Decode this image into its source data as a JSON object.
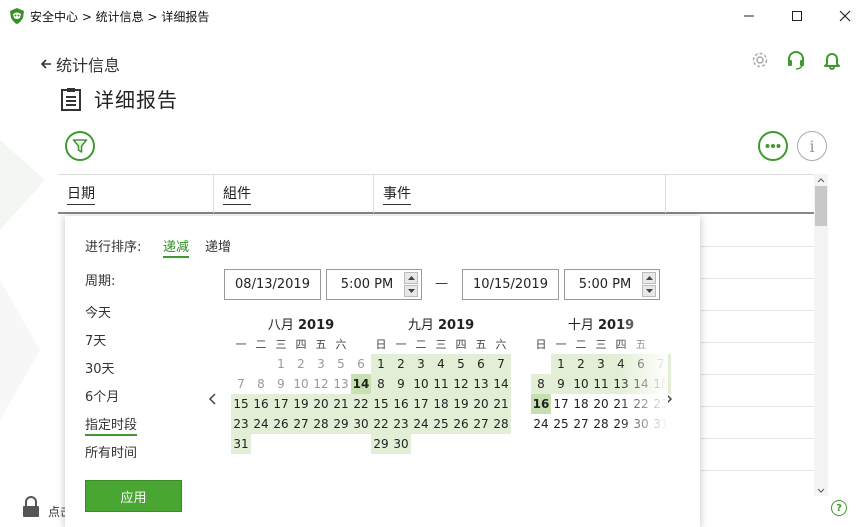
{
  "window": {
    "title": "安全中心 > 统计信息 > 详细报告"
  },
  "header": {
    "back_label": "统计信息",
    "page_title": "详细报告"
  },
  "table": {
    "columns": [
      "日期",
      "組件",
      "事件"
    ]
  },
  "footer": {
    "lock_text": "点击"
  },
  "filter": {
    "sort_label": "进行排序:",
    "sort_desc": "递减",
    "sort_asc": "递增",
    "period_label": "周期:",
    "periods": [
      "今天",
      "7天",
      "30天",
      "6个月",
      "指定时段",
      "所有时间"
    ],
    "active_period": "指定时段",
    "start_date": "08/13/2019",
    "start_time": "5:00 PM",
    "end_date": "10/15/2019",
    "end_time": "5:00 PM",
    "range_dash": "—",
    "apply_label": "应用"
  },
  "calendars": [
    {
      "month": "八月",
      "year": "2019",
      "weekdays": [
        "一",
        "二",
        "三",
        "四",
        "五",
        "六"
      ],
      "weeks": [
        [
          "",
          "",
          "",
          "1",
          "2",
          "3"
        ],
        [
          "5",
          "6",
          "7",
          "8",
          "9",
          "10"
        ],
        [
          "12",
          "13",
          "14",
          "15",
          "16",
          "17"
        ],
        [
          "19",
          "20",
          "21",
          "22",
          "23",
          "24"
        ],
        [
          "26",
          "27",
          "28",
          "29",
          "30",
          "31"
        ]
      ]
    },
    {
      "month": "九月",
      "year": "2019",
      "weekdays": [
        "日",
        "一",
        "二",
        "三",
        "四",
        "五",
        "六"
      ],
      "weeks": [
        [
          "1",
          "2",
          "3",
          "4",
          "5",
          "6",
          "7"
        ],
        [
          "8",
          "9",
          "10",
          "11",
          "12",
          "13",
          "14"
        ],
        [
          "15",
          "16",
          "17",
          "18",
          "19",
          "20",
          "21"
        ],
        [
          "22",
          "23",
          "24",
          "25",
          "26",
          "27",
          "28"
        ],
        [
          "29",
          "30",
          "",
          "",
          "",
          "",
          ""
        ]
      ]
    },
    {
      "month": "十月",
      "year": "2019",
      "weekdays": [
        "日",
        "一",
        "二",
        "三",
        "四",
        "五"
      ],
      "weeks": [
        [
          "",
          "",
          "1",
          "2",
          "3",
          "4"
        ],
        [
          "6",
          "7",
          "8",
          "9",
          "10",
          "11"
        ],
        [
          "13",
          "14",
          "15",
          "16",
          "17",
          "18"
        ],
        [
          "20",
          "21",
          "22",
          "23",
          "24",
          "25"
        ],
        [
          "27",
          "28",
          "29",
          "30",
          "31",
          ""
        ]
      ]
    }
  ],
  "selection": {
    "start_day": "14",
    "end_day": "16"
  },
  "colors": {
    "accent": "#3e9a2d",
    "apply_button": "#49a632",
    "range_fill": "#e2efd6",
    "range_edge": "#c7e0b2"
  }
}
